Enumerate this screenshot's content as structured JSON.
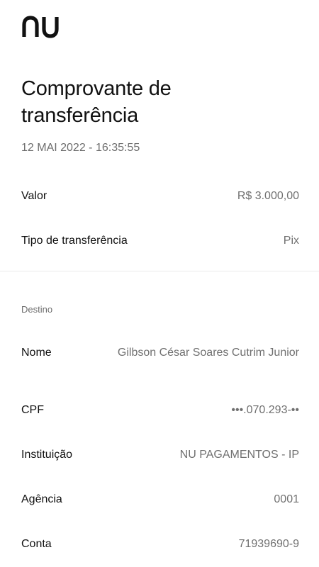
{
  "brand": {
    "logo_text": "nu"
  },
  "receipt": {
    "title": "Comprovante de transferência",
    "timestamp": "12 MAI 2022 - 16:35:55"
  },
  "summary": {
    "valor_label": "Valor",
    "valor_value": "R$ 3.000,00",
    "tipo_label": "Tipo de transferência",
    "tipo_value": "Pix"
  },
  "destino": {
    "section_label": "Destino",
    "nome_label": "Nome",
    "nome_value": "Gilbson César Soares Cutrim Junior",
    "cpf_label": "CPF",
    "cpf_value": "•••.070.293-••",
    "instituicao_label": "Instituição",
    "instituicao_value": "NU PAGAMENTOS - IP",
    "agencia_label": "Agência",
    "agencia_value": "0001",
    "conta_label": "Conta",
    "conta_value": "71939690-9"
  }
}
